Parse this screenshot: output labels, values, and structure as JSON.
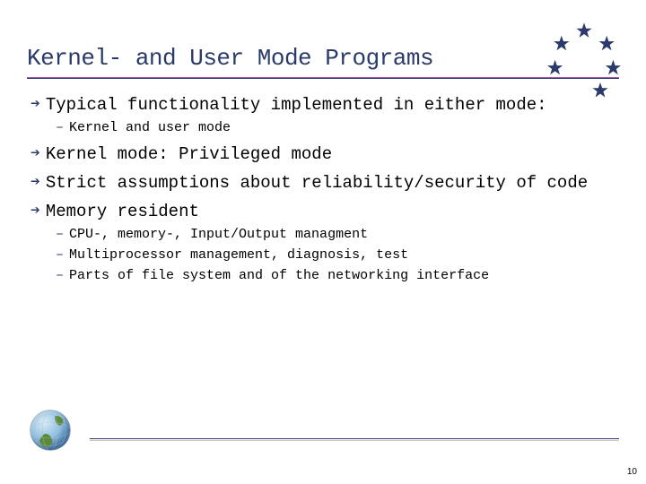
{
  "title": "Kernel- and User Mode Programs",
  "bullets": {
    "b0": "Typical functionality implemented in either mode:",
    "b0_sub0": "Kernel and user mode",
    "b1": "Kernel mode: Privileged mode",
    "b2": "Strict assumptions about reliability/security of code",
    "b3": "Memory resident",
    "b3_sub0": "CPU-, memory-, Input/Output managment",
    "b3_sub1": "Multiprocessor management, diagnosis, test",
    "b3_sub2": "Parts of file system and of the networking interface"
  },
  "page_number": "10"
}
